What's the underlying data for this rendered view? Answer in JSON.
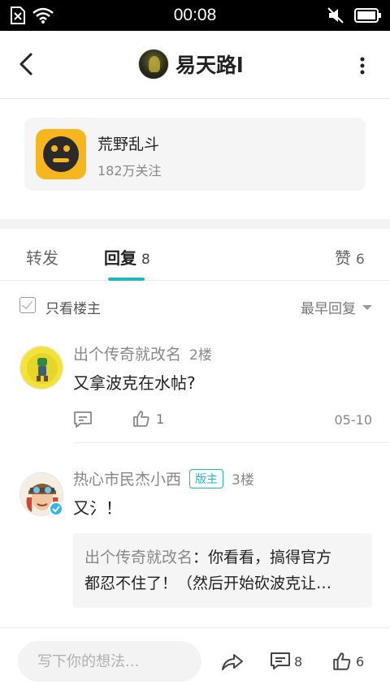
{
  "status_bar": {
    "time": "00:08"
  },
  "header": {
    "user_name": "易天路l"
  },
  "forum": {
    "name": "荒野乱斗",
    "followers": "182万关注"
  },
  "tabs": [
    {
      "label": "转发",
      "count": ""
    },
    {
      "label": "回复",
      "count": "8"
    },
    {
      "label": "赞",
      "count": "6"
    }
  ],
  "filter": {
    "only_op_label": "只看楼主",
    "sort_label": "最早回复"
  },
  "replies": [
    {
      "author": "出个传奇就改名",
      "floor": "2楼",
      "badge": "",
      "text": "又拿波克在水帖?",
      "likes": "1",
      "date": "05-10"
    },
    {
      "author": "热心市民杰小西",
      "floor": "3楼",
      "badge": "版主",
      "text": "又氵！",
      "quote": {
        "author": "出个传奇就改名",
        "sep": "：",
        "line1": "你看看，搞得官方",
        "line2": "都忍不住了！（然后开始砍波克让…"
      }
    }
  ],
  "bottom_bar": {
    "placeholder": "写下你的想法...",
    "comment_count": "8",
    "like_count": "6"
  },
  "colors": {
    "accent": "#1fb9bf",
    "forum_icon_bg": "#f7b51e"
  }
}
